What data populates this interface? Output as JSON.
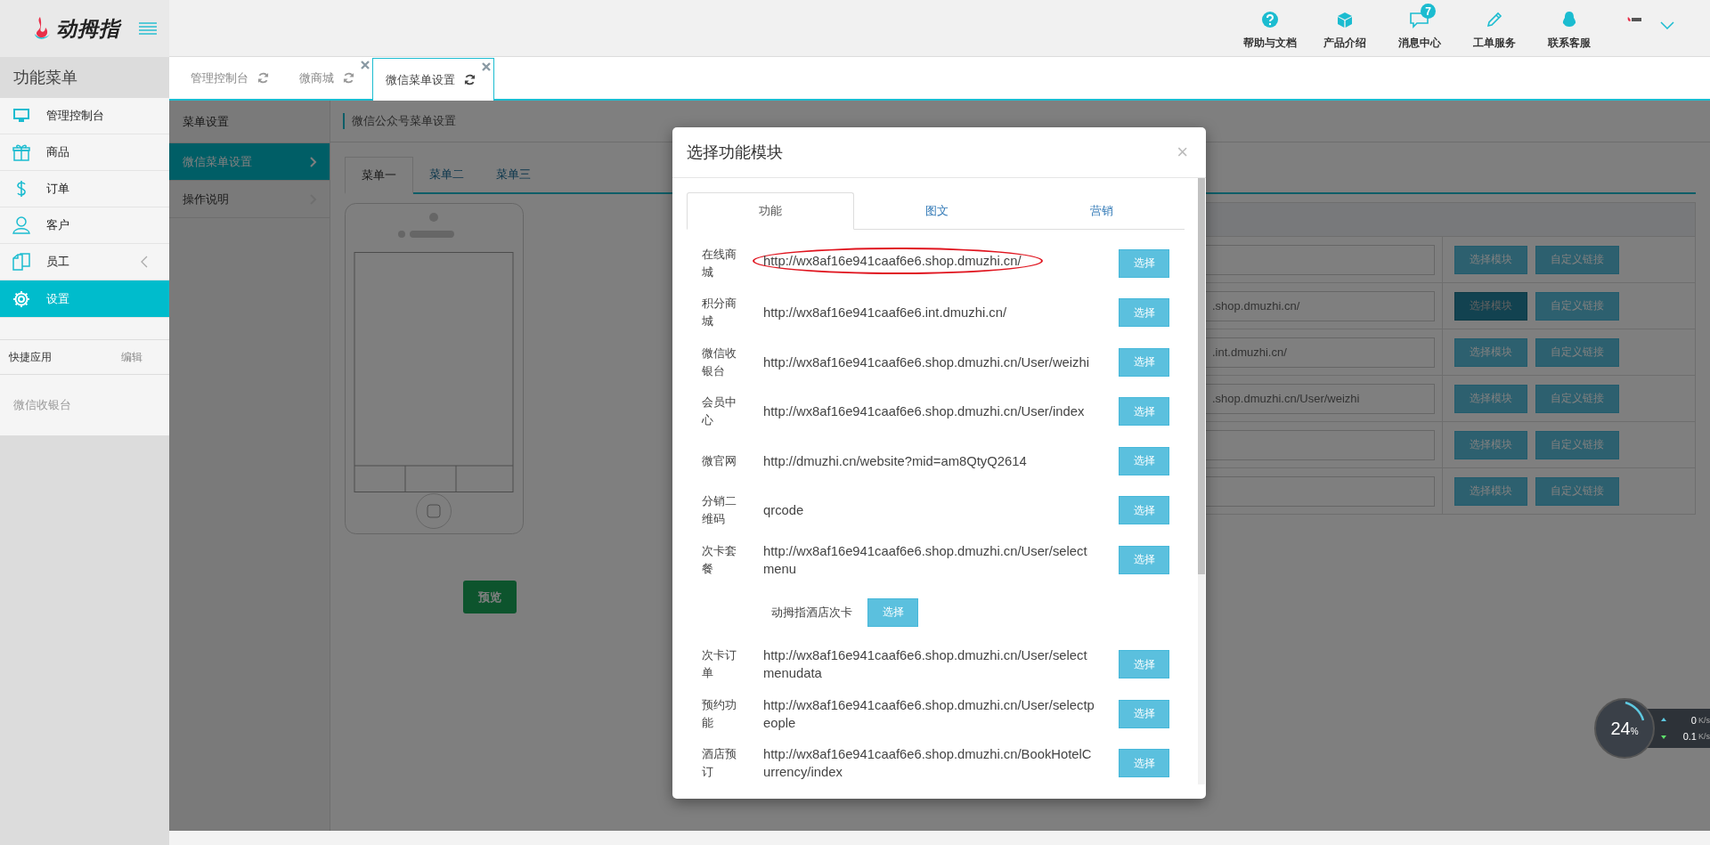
{
  "logo": {
    "text": "动拇指"
  },
  "header_links": [
    {
      "label": "帮助与文档"
    },
    {
      "label": "产品介绍"
    },
    {
      "label": "消息中心",
      "badge": "7"
    },
    {
      "label": "工单服务"
    },
    {
      "label": "联系客服"
    }
  ],
  "sidebar": {
    "title": "功能菜单",
    "items": [
      {
        "label": "管理控制台",
        "selected": false,
        "expandable": false
      },
      {
        "label": "商品",
        "selected": false,
        "expandable": false
      },
      {
        "label": "订单",
        "selected": false,
        "expandable": false
      },
      {
        "label": "客户",
        "selected": false,
        "expandable": false
      },
      {
        "label": "员工",
        "selected": false,
        "expandable": true
      },
      {
        "label": "设置",
        "selected": true,
        "expandable": false
      }
    ],
    "quick_apps": {
      "title": "快捷应用",
      "edit": "编辑",
      "items": [
        "微信收银台"
      ]
    }
  },
  "page_tabs": [
    {
      "label": "管理控制台",
      "selected": false,
      "closable": false
    },
    {
      "label": "微商城",
      "selected": false,
      "closable": true
    },
    {
      "label": "微信菜单设置",
      "selected": true,
      "closable": true
    }
  ],
  "submenu": {
    "title": "菜单设置",
    "items": [
      {
        "label": "微信菜单设置",
        "selected": true
      },
      {
        "label": "操作说明",
        "selected": false
      }
    ]
  },
  "content": {
    "title": "微信公众号菜单设置",
    "menu_tabs": [
      {
        "label": "菜单一",
        "selected": true
      },
      {
        "label": "菜单二",
        "selected": false
      },
      {
        "label": "菜单三",
        "selected": false
      }
    ],
    "preview_button": "预览",
    "table_rows": [
      {
        "buttons": [
          "选择模块",
          "自定义链接"
        ],
        "active": false
      },
      {
        "value": ".shop.dmuzhi.cn/",
        "buttons": [
          "选择模块",
          "自定义链接"
        ],
        "active": true
      },
      {
        "value": ".int.dmuzhi.cn/",
        "buttons": [
          "选择模块",
          "自定义链接"
        ],
        "active": false
      },
      {
        "value": ".shop.dmuzhi.cn/User/weizhi",
        "buttons": [
          "选择模块",
          "自定义链接"
        ],
        "active": false
      },
      {
        "buttons": [
          "选择模块",
          "自定义链接"
        ],
        "active": false
      },
      {
        "buttons": [
          "选择模块",
          "自定义链接"
        ],
        "active": false
      }
    ]
  },
  "modal": {
    "title": "选择功能模块",
    "close": "×",
    "tabs": [
      {
        "label": "功能",
        "selected": true
      },
      {
        "label": "图文",
        "selected": false
      },
      {
        "label": "营销",
        "selected": false
      }
    ],
    "rows": [
      {
        "kind": "link",
        "label": "在线商城",
        "url": "http://wx8af16e941caaf6e6.shop.dmuzhi.cn/",
        "button": "选择",
        "highlighted": true
      },
      {
        "kind": "link",
        "label": "积分商城",
        "url": "http://wx8af16e941caaf6e6.int.dmuzhi.cn/",
        "button": "选择",
        "highlighted": false
      },
      {
        "kind": "link",
        "label": "微信收银台",
        "url": "http://wx8af16e941caaf6e6.shop.dmuzhi.cn/User/weizhi",
        "button": "选择",
        "highlighted": false
      },
      {
        "kind": "link",
        "label": "会员中心",
        "url": "http://wx8af16e941caaf6e6.shop.dmuzhi.cn/User/index",
        "button": "选择",
        "highlighted": false
      },
      {
        "kind": "link",
        "label": "微官网",
        "url": "http://dmuzhi.cn/website?mid=am8QtyQ2614",
        "button": "选择",
        "highlighted": false
      },
      {
        "kind": "link",
        "label": "分销二维码",
        "url": "qrcode",
        "button": "选择",
        "highlighted": false
      },
      {
        "kind": "link",
        "label": "次卡套餐",
        "url": "http://wx8af16e941caaf6e6.shop.dmuzhi.cn/User/selectmenu",
        "button": "选择",
        "highlighted": false
      },
      {
        "kind": "sub",
        "label": "动拇指酒店次卡",
        "button": "选择"
      },
      {
        "kind": "link",
        "label": "次卡订单",
        "url": "http://wx8af16e941caaf6e6.shop.dmuzhi.cn/User/selectmenudata",
        "button": "选择",
        "highlighted": false
      },
      {
        "kind": "link",
        "label": "预约功能",
        "url": "http://wx8af16e941caaf6e6.shop.dmuzhi.cn/User/selectpeople",
        "button": "选择",
        "highlighted": false
      },
      {
        "kind": "link",
        "label": "酒店预订",
        "url": "http://wx8af16e941caaf6e6.shop.dmuzhi.cn/BookHotelCurrency/index",
        "button": "选择",
        "highlighted": false
      }
    ]
  },
  "speed_widget": {
    "percent": "24",
    "percent_unit": "%",
    "up": "0",
    "up_unit": "K/s",
    "down": "0.1",
    "down_unit": "K/s"
  }
}
